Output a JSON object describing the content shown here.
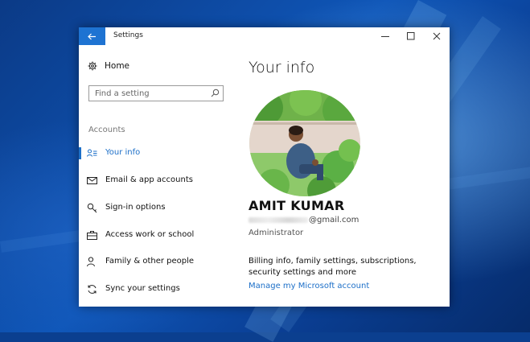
{
  "window": {
    "title": "Settings"
  },
  "sidebar": {
    "home_label": "Home",
    "search_placeholder": "Find a setting",
    "section_label": "Accounts",
    "items": [
      {
        "label": "Your info",
        "icon": "person-card-icon",
        "active": true
      },
      {
        "label": "Email & app accounts",
        "icon": "envelope-icon",
        "active": false
      },
      {
        "label": "Sign-in options",
        "icon": "key-icon",
        "active": false
      },
      {
        "label": "Access work or school",
        "icon": "briefcase-icon",
        "active": false
      },
      {
        "label": "Family & other people",
        "icon": "person-add-icon",
        "active": false
      },
      {
        "label": "Sync your settings",
        "icon": "sync-icon",
        "active": false
      }
    ]
  },
  "main": {
    "title": "Your info",
    "user": {
      "name": "AMIT KUMAR",
      "email_visible": "@gmail.com",
      "role": "Administrator"
    },
    "billing_text": "Billing info, family settings, subscriptions, security settings and more",
    "manage_link": "Manage my Microsoft account"
  },
  "colors": {
    "accent": "#1c6fc8",
    "titlebar_back": "#1e73d2"
  }
}
